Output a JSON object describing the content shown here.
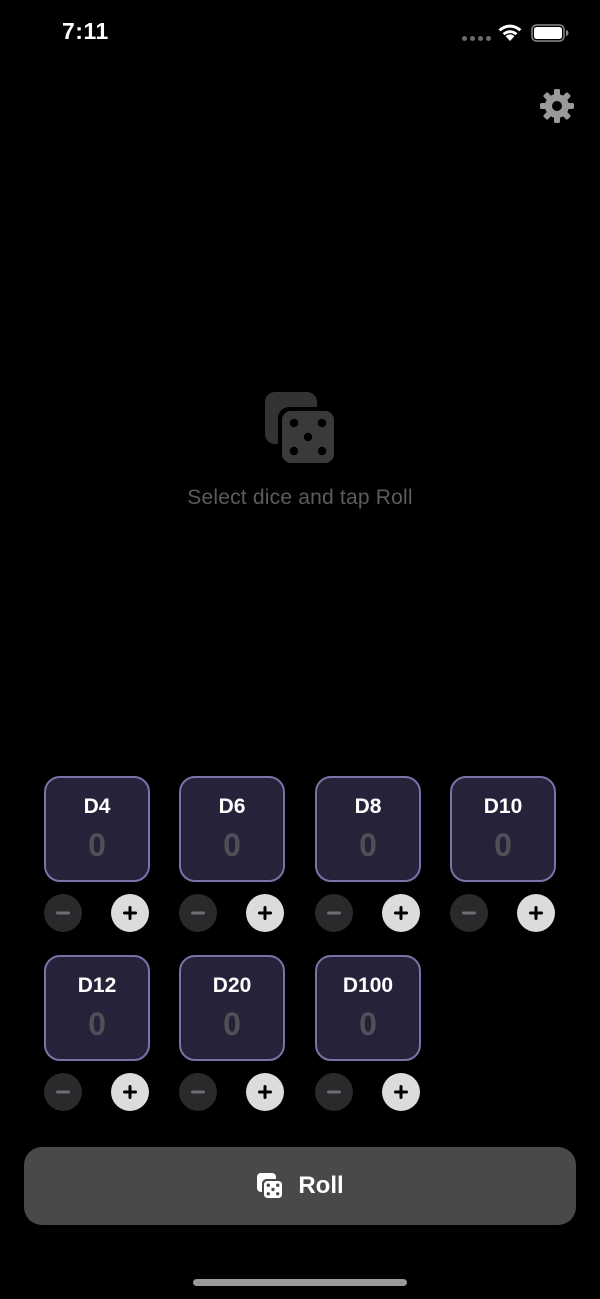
{
  "status_bar": {
    "time": "7:11"
  },
  "icons": {
    "settings": "gear-icon",
    "empty_state": "dice-icon",
    "roll": "dice-icon",
    "decrement": "minus-icon",
    "increment": "plus-icon"
  },
  "empty_state": {
    "message": "Select dice and tap Roll"
  },
  "dice": [
    {
      "label": "D4",
      "count": "0"
    },
    {
      "label": "D6",
      "count": "0"
    },
    {
      "label": "D8",
      "count": "0"
    },
    {
      "label": "D10",
      "count": "0"
    },
    {
      "label": "D12",
      "count": "0"
    },
    {
      "label": "D20",
      "count": "0"
    },
    {
      "label": "D100",
      "count": "0"
    }
  ],
  "roll_button": {
    "label": "Roll"
  },
  "colors": {
    "background": "#000000",
    "card_border": "#7b72a8",
    "card_background": "#24233a",
    "roll_button": "#49494b"
  }
}
